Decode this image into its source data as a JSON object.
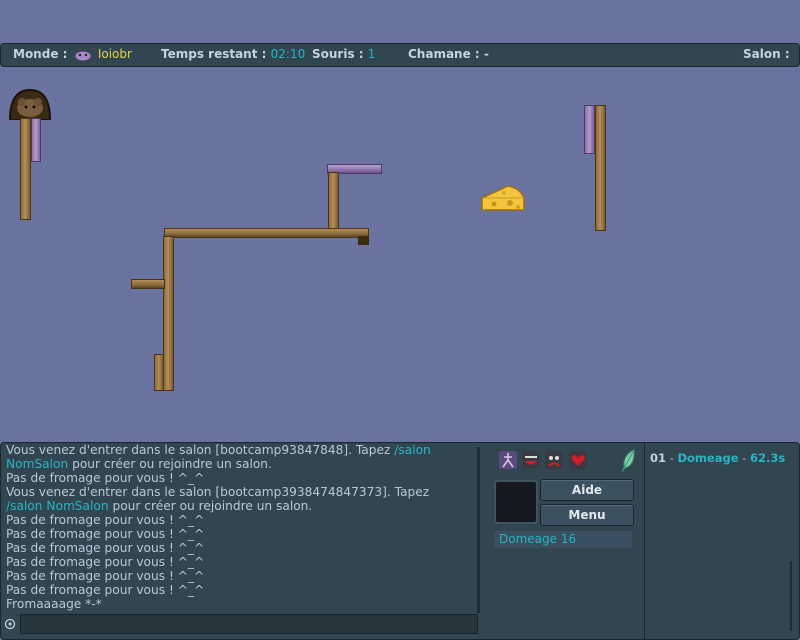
{
  "topbar": {
    "monde_label": "Monde :",
    "monde_value": "Ioiobr",
    "temps_label": "Temps restant :",
    "temps_value": "02:10",
    "souris_label": "Souris :",
    "souris_value": "1",
    "chamane_label": "Chamane :",
    "chamane_value": "-",
    "salon_label": "Salon :"
  },
  "chat": {
    "lines": [
      {
        "a": "Vous venez d'entrer dans le salon [bootcamp93847848]. Tapez ",
        "b": "/salon"
      },
      {
        "b": "NomSalon",
        "a": " pour créer ou rejoindre un salon."
      },
      {
        "a": "Pas de fromage pour vous ! ^_^"
      },
      {
        "a": "Vous venez d'entrer dans le salon [bootcamp3938474847373]. Tapez"
      },
      {
        "b": "/salon NomSalon",
        "a": " pour créer ou rejoindre un salon."
      },
      {
        "a": "Pas de fromage pour vous ! ^_^"
      },
      {
        "a": "Pas de fromage pour vous ! ^_^"
      },
      {
        "a": "Pas de fromage pour vous ! ^_^"
      },
      {
        "a": "Pas de fromage pour vous ! ^_^"
      },
      {
        "a": "Pas de fromage pour vous ! ^_^"
      },
      {
        "a": "Pas de fromage pour vous ! ^_^"
      },
      {
        "a": "Fromaaaage *-*"
      }
    ],
    "input_value": ""
  },
  "panel": {
    "aide_label": "Aide",
    "menu_label": "Menu",
    "player_chip": "Domeage 16",
    "emotes": [
      "dance-icon",
      "laugh-icon",
      "cry-icon",
      "heart-icon"
    ]
  },
  "scores": {
    "rank": "01",
    "sep": " - ",
    "name": "Domeage",
    "time": "62.3s"
  },
  "colors": {
    "background": "#6a739f",
    "panel": "#324652",
    "accent_cyan": "#27b4c4",
    "accent_yellow": "#e2d147"
  }
}
